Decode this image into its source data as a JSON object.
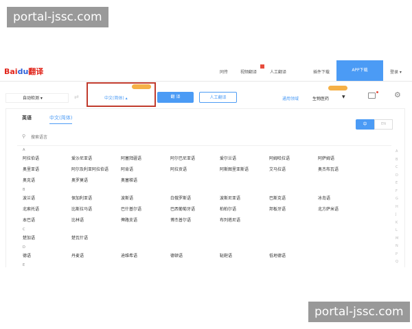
{
  "watermark": "portal-jssc.com",
  "header": {
    "logo_text": "Bai",
    "logo_du": "du",
    "logo_suffix": "翻译",
    "nav": [
      "同传",
      "视频翻译",
      "人工翻译",
      "插件下载"
    ],
    "app_download": "APP下载",
    "login": "登录 ▾"
  },
  "toolbar": {
    "source_lang": "自动检测",
    "target_lang": "中文(简体)",
    "translate": "翻 译",
    "human_translate": "人工翻译",
    "domain_label": "通用领域",
    "domain_value": "生物医药"
  },
  "panel": {
    "tabs": [
      "英语",
      "中文(简体)"
    ],
    "toggle": [
      "中",
      "EN"
    ],
    "search_placeholder": "搜索语言",
    "groups": [
      {
        "letter": "A",
        "langs": [
          "阿拉伯语",
          "爱沙尼亚语",
          "阿塞拜疆语",
          "阿尔巴尼亚语",
          "爱尔兰语",
          "阿姆哈拉语",
          "阿萨姆语",
          "奥里亚语",
          "阿尔及利亚阿拉伯语",
          "阿肯语",
          "阿拉贡语",
          "阿斯图里亚斯语",
          "艾马拉语",
          "奥杰布瓦语",
          "奥克语",
          "奥罗莫语",
          "奥塞梯语"
        ]
      },
      {
        "letter": "B",
        "langs": [
          "波兰语",
          "保加利亚语",
          "波斯语",
          "白俄罗斯语",
          "波斯尼亚语",
          "巴斯克语",
          "冰岛语",
          "北索托语",
          "比斯拉马语",
          "巴什基尔语",
          "巴西葡萄牙语",
          "柏柏尔语",
          "邦板牙语",
          "北方萨米语",
          "本巴语",
          "比林语",
          "俾路支语",
          "博杰普尔语",
          "布列塔尼语"
        ]
      },
      {
        "letter": "C",
        "langs": [
          "楚加语",
          "楚瓦什语"
        ]
      },
      {
        "letter": "D",
        "langs": [
          "德语",
          "丹麦语",
          "迪维希语",
          "德顿语",
          "鞑靼语",
          "低地德语"
        ]
      },
      {
        "letter": "E",
        "langs": []
      }
    ],
    "alphabet": [
      "A",
      "B",
      "C",
      "D",
      "E",
      "F",
      "G",
      "H",
      "J",
      "K",
      "L",
      "M",
      "N",
      "P",
      "Q"
    ]
  },
  "colors": {
    "accent": "#4b9bf5",
    "highlight_border": "#c0392b",
    "badge": "#f5b046"
  }
}
